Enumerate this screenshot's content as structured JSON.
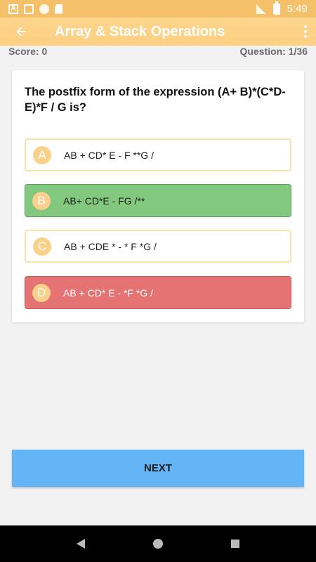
{
  "status_bar": {
    "time": "5:49",
    "icons": [
      "a-notification-icon",
      "gmail-icon",
      "circle-notification-icon",
      "sd-card-icon",
      "signal-icon",
      "battery-icon"
    ]
  },
  "app_bar": {
    "title": "Array & Stack Operations",
    "back_icon": "arrow-back-icon",
    "menu_icon": "more-vert-icon"
  },
  "quiz": {
    "score": "Score: 0",
    "question_counter": "Question: 1/36",
    "question_text": "The postfix form of the expression (A+ B)*(C*D-E)*F / G is?",
    "options": [
      {
        "letter": "A",
        "text": "AB + CD* E - F **G /",
        "state": "neutral"
      },
      {
        "letter": "B",
        "text": "AB+ CD*E - FG /**",
        "state": "correct"
      },
      {
        "letter": "C",
        "text": "AB + CDE * - * F *G /",
        "state": "neutral"
      },
      {
        "letter": "D",
        "text": "AB + CD* E - *F *G /",
        "state": "wrong"
      }
    ],
    "next_label": "NEXT"
  },
  "colors": {
    "app_bar": "#fdd58d",
    "status_bar": "#f5c06a",
    "correct": "#82c97f",
    "wrong": "#e57373",
    "next_button": "#64b5f6"
  }
}
